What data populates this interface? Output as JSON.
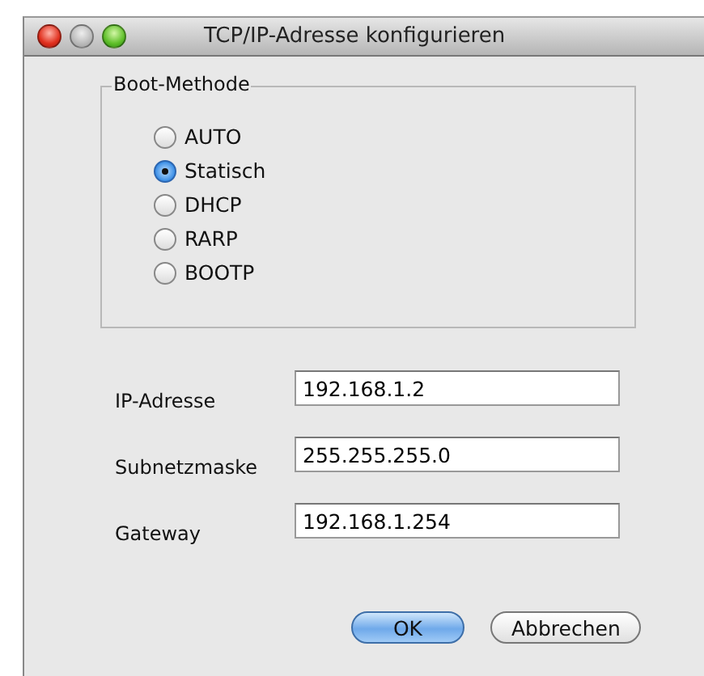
{
  "window": {
    "title": "TCP/IP-Adresse konfigurieren"
  },
  "boot_method": {
    "label": "Boot-Methode",
    "options": [
      {
        "label": "AUTO",
        "selected": false
      },
      {
        "label": "Statisch",
        "selected": true
      },
      {
        "label": "DHCP",
        "selected": false
      },
      {
        "label": "RARP",
        "selected": false
      },
      {
        "label": "BOOTP",
        "selected": false
      }
    ]
  },
  "fields": [
    {
      "label": "IP-Adresse",
      "value": "192.168.1.2"
    },
    {
      "label": "Subnetzmaske",
      "value": "255.255.255.0"
    },
    {
      "label": "Gateway",
      "value": "192.168.1.254"
    }
  ],
  "buttons": [
    {
      "label": "OK",
      "default": true
    },
    {
      "label": "Abbrechen",
      "default": false
    }
  ]
}
